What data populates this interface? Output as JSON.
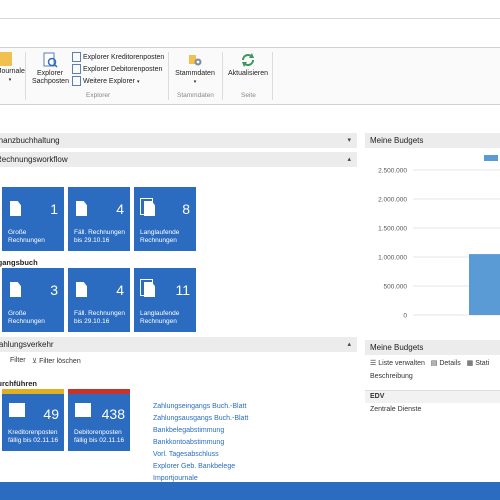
{
  "ribbon": {
    "journals_label": "Journale",
    "explorer_sachposten_label": "Explorer Sachposten",
    "explorer_kreditorenposten": "Explorer Kreditorenposten",
    "explorer_debitorenposten": "Explorer Debitorenposten",
    "weitere_explorer": "Weitere Explorer",
    "group_explorer": "Explorer",
    "stammdaten_label": "Stammdaten",
    "group_stammdaten": "Stammdaten",
    "aktualisieren_label": "Aktualisieren",
    "group_seite": "Seite"
  },
  "sections": {
    "finanzbuchhaltung": "Finanzbuchhaltung",
    "rechnungsworkflow": "Rechnungsworkflow",
    "eingangsbuch": "Eingangsbuch",
    "zahlungsverkehr": "Zahlungsverkehr",
    "durchfuehren": "Durchführen"
  },
  "tiles_row1": [
    {
      "value": "1",
      "label1": "Große",
      "label2": "Rechnungen"
    },
    {
      "value": "4",
      "label1": "Fäll. Rechnungen",
      "label2": "bis 29.10.16"
    },
    {
      "value": "8",
      "label1": "Langlaufende",
      "label2": "Rechnungen"
    }
  ],
  "tiles_row2": [
    {
      "value": "3",
      "label1": "Große",
      "label2": "Rechnungen"
    },
    {
      "value": "4",
      "label1": "Fäll. Rechnungen",
      "label2": "bis 29.10.16"
    },
    {
      "value": "11",
      "label1": "Langlaufende",
      "label2": "Rechnungen"
    }
  ],
  "filter": {
    "filter_label": "Filter",
    "filter_clear_label": "Filter löschen"
  },
  "tiles_row3": [
    {
      "value": "49",
      "label1": "Kreditorenposten",
      "label2": "fällig bis 02.11.16"
    },
    {
      "value": "438",
      "label1": "Debitorenposten",
      "label2": "fällig bis 02.11.16"
    }
  ],
  "links": [
    "Zahlungseingangs Buch.-Blatt",
    "Zahlungsausgangs Buch.-Blatt",
    "Bankbelegabstimmung",
    "Bankkontoabstimmung",
    "Vorl. Tagesabschluss",
    "Explorer Geb. Bankbelege",
    "Importjournale"
  ],
  "budget_chart_panel": {
    "title": "Meine Budgets"
  },
  "chart_data": {
    "type": "bar",
    "title": "",
    "categories": [
      ""
    ],
    "series": [
      {
        "values": [
          1050000
        ]
      }
    ],
    "y_ticks": [
      "0",
      "500.000",
      "1.000.000",
      "1.500.000",
      "2.000.000",
      "2.500.000"
    ],
    "ylim": [
      0,
      2500000
    ],
    "grid": true,
    "legend": "top-right",
    "bar_color": "#5b9bd5"
  },
  "budget_list_panel": {
    "title": "Meine Budgets",
    "toolbar": [
      "Liste verwalten",
      "Details",
      "Stati"
    ],
    "column_header": "Beschreibung",
    "rows": [
      "EDV",
      "Zentrale Dienste"
    ]
  }
}
